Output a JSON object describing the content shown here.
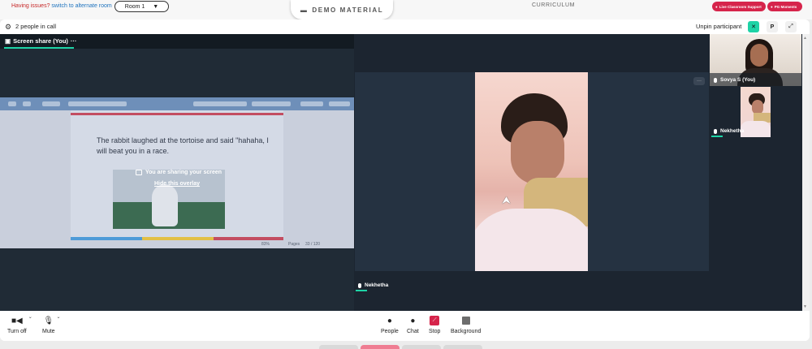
{
  "topbar": {
    "issue_text": "Having issues?",
    "switch_link": "switch to alternate room",
    "room_select": "Room 1",
    "demo_tab": "DEMO MATERIAL",
    "curriculum": "CURRICULUM",
    "live_support": "Live Classroom Support",
    "pg_moments": "PG Moments",
    "brand_color": "#d6244b"
  },
  "callbar": {
    "people_count": "2 people in call",
    "unpin": "Unpin participant",
    "p_button": "P"
  },
  "share": {
    "tab_label": "Screen share (You)",
    "slide_text": "The rabbit laughed at the tortoise and said \"hahaha, I will beat you in a race.",
    "overlay_message": "You are sharing your screen",
    "overlay_link": "Hide this overlay",
    "footer_zoom": "83%",
    "footer_pages": "Pages",
    "footer_page_count": "33 / 120"
  },
  "main_video": {
    "name": "Nekhetha",
    "more": "···"
  },
  "thumbnails": [
    {
      "name": "Sovya S (You)"
    },
    {
      "name": "Nekhetha"
    }
  ],
  "controls": {
    "turn_off": "Turn off",
    "mute": "Mute",
    "people": "People",
    "chat": "Chat",
    "stop": "Stop",
    "background": "Background"
  },
  "colors": {
    "accent": "#1ed3a6",
    "stage": "#1c2530"
  }
}
